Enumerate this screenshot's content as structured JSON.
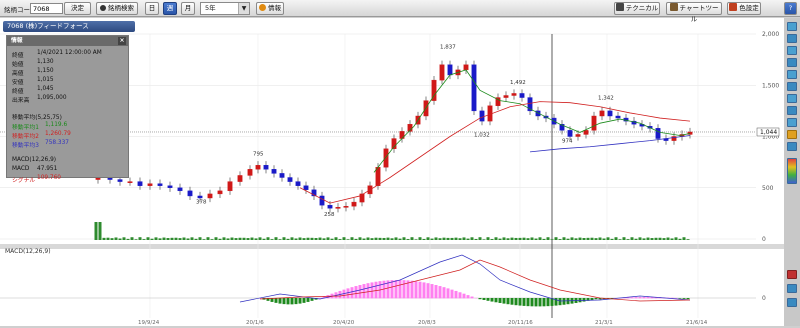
{
  "toolbar": {
    "code_label": "銘柄コード",
    "code_value": "7068",
    "decide_label": "決定",
    "search_label": "銘柄検索",
    "period_buttons": [
      {
        "label": "日",
        "active": false
      },
      {
        "label": "週",
        "active": true
      },
      {
        "label": "月",
        "active": false
      }
    ],
    "range_value": "5年",
    "info_label": "情報",
    "technical_label": "テクニカル",
    "charttool_label": "チャートツール",
    "color_label": "色設定",
    "help_label": "?"
  },
  "stock_title": "7068 (株)フィードフォース",
  "info_panel": {
    "title": "情報",
    "rows": [
      {
        "label": "終値",
        "value": "1/4/2021 12:00:00 AM"
      },
      {
        "label": "始値",
        "value": "1,130"
      },
      {
        "label": "高値",
        "value": "1,150"
      },
      {
        "label": "安値",
        "value": "1,015"
      },
      {
        "label": "終値",
        "value": "1,045"
      },
      {
        "label": "出来高",
        "value": "1,095,000"
      }
    ],
    "ma_title": "移動平均(5,25,75)",
    "ma_rows": [
      {
        "label": "移動平均1",
        "value": "1,119.6",
        "color": "#1a8a1a"
      },
      {
        "label": "移動平均2",
        "value": "1,260.79",
        "color": "#d02020"
      },
      {
        "label": "移動平均3",
        "value": "758.337",
        "color": "#3030c0"
      }
    ],
    "macd_title": "MACD(12,26,9)",
    "macd_rows": [
      {
        "label": "MACD",
        "value": "47.951",
        "color": "#222222"
      },
      {
        "label": "シグナル",
        "value": "109.760",
        "color": "#d02020"
      }
    ]
  },
  "chart_data": [
    {
      "type": "candlestick",
      "title": "",
      "ylim": [
        0,
        2000
      ],
      "y_ticks": [
        "2,000",
        "1,500",
        "1,000",
        "500",
        "0"
      ],
      "current_price": "1,044",
      "x_ticks": [
        "19/9/24",
        "20/1/6",
        "20/4/20",
        "20/8/3",
        "20/11/16",
        "21/3/1",
        "21/6/14"
      ],
      "annotations": [
        {
          "text": "1,837"
        },
        {
          "text": "795"
        },
        {
          "text": "378"
        },
        {
          "text": "258"
        },
        {
          "text": "1,492"
        },
        {
          "text": "1,032"
        },
        {
          "text": "974"
        },
        {
          "text": "1,342"
        }
      ],
      "series": [
        {
          "name": "移動平均1",
          "color": "#1a8a1a"
        },
        {
          "name": "移動平均2",
          "color": "#d02020"
        },
        {
          "name": "移動平均3",
          "color": "#3030c0"
        }
      ]
    },
    {
      "type": "bar",
      "title": "MACD(12,26,9)",
      "y_ticks": [
        "0"
      ],
      "series": [
        {
          "name": "MACD",
          "color": "#3030c0"
        },
        {
          "name": "シグナル",
          "color": "#d02020"
        }
      ]
    }
  ]
}
